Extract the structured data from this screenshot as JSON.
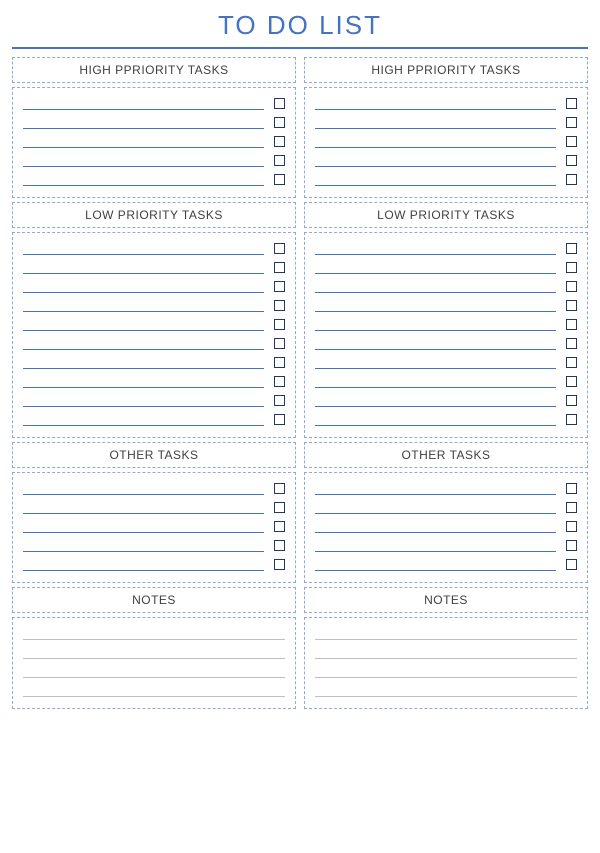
{
  "title": "TO DO LIST",
  "columns": [
    {
      "sections": [
        {
          "header": "HIGH PPRIORITY TASKS",
          "type": "tasks",
          "rows": 5
        },
        {
          "header": "LOW PRIORITY TASKS",
          "type": "tasks",
          "rows": 10
        },
        {
          "header": "OTHER TASKS",
          "type": "tasks",
          "rows": 5
        },
        {
          "header": "NOTES",
          "type": "notes",
          "rows": 4
        }
      ]
    },
    {
      "sections": [
        {
          "header": "HIGH PPRIORITY TASKS",
          "type": "tasks",
          "rows": 5
        },
        {
          "header": "LOW PRIORITY TASKS",
          "type": "tasks",
          "rows": 10
        },
        {
          "header": "OTHER TASKS",
          "type": "tasks",
          "rows": 5
        },
        {
          "header": "NOTES",
          "type": "notes",
          "rows": 4
        }
      ]
    }
  ]
}
